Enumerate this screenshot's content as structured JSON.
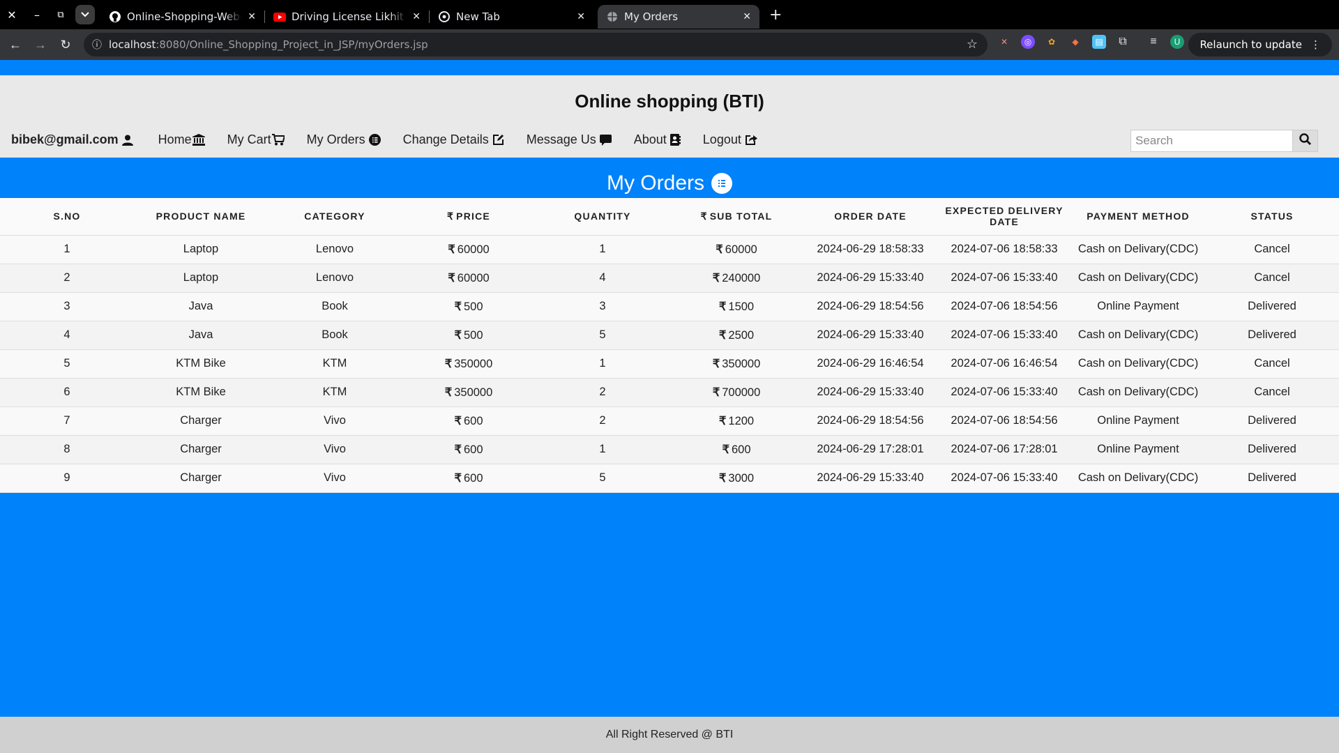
{
  "browser": {
    "tabs": [
      {
        "title": "Online-Shopping-Web-Project",
        "favicon": "github-icon",
        "active": false
      },
      {
        "title": "Driving License Likhit Questions",
        "favicon": "youtube-icon",
        "active": false
      },
      {
        "title": "New Tab",
        "favicon": "chrome-icon",
        "active": false
      },
      {
        "title": "My Orders",
        "favicon": "globe-icon",
        "active": true
      }
    ],
    "url_host": "localhost",
    "url_rest": ":8080/Online_Shopping_Project_in_JSP/myOrders.jsp",
    "relaunch_label": "Relaunch to update",
    "profile_initial": "U"
  },
  "header": {
    "site_title": "Online shopping (BTI)",
    "user_email": "bibek@gmail.com",
    "nav": {
      "home": "Home",
      "cart": "My Cart",
      "orders": "My Orders",
      "change_details": "Change Details",
      "message": "Message Us",
      "about": "About",
      "logout": "Logout"
    },
    "search_placeholder": "Search"
  },
  "page": {
    "title": "My Orders"
  },
  "table": {
    "columns": [
      "S.NO",
      "PRODUCT NAME",
      "CATEGORY",
      "PRICE",
      "QUANTITY",
      "SUB TOTAL",
      "ORDER DATE",
      "EXPECTED DELIVERY DATE",
      "PAYMENT METHOD",
      "STATUS"
    ],
    "currency_symbol": "₹",
    "rows": [
      {
        "sno": "1",
        "product": "Laptop",
        "category": "Lenovo",
        "price": "60000",
        "quantity": "1",
        "subtotal": "60000",
        "order_date": "2024-06-29 18:58:33",
        "delivery_date": "2024-07-06 18:58:33",
        "payment": "Cash on Delivary(CDC)",
        "status": "Cancel"
      },
      {
        "sno": "2",
        "product": "Laptop",
        "category": "Lenovo",
        "price": "60000",
        "quantity": "4",
        "subtotal": "240000",
        "order_date": "2024-06-29 15:33:40",
        "delivery_date": "2024-07-06 15:33:40",
        "payment": "Cash on Delivary(CDC)",
        "status": "Cancel"
      },
      {
        "sno": "3",
        "product": "Java",
        "category": "Book",
        "price": "500",
        "quantity": "3",
        "subtotal": "1500",
        "order_date": "2024-06-29 18:54:56",
        "delivery_date": "2024-07-06 18:54:56",
        "payment": "Online Payment",
        "status": "Delivered"
      },
      {
        "sno": "4",
        "product": "Java",
        "category": "Book",
        "price": "500",
        "quantity": "5",
        "subtotal": "2500",
        "order_date": "2024-06-29 15:33:40",
        "delivery_date": "2024-07-06 15:33:40",
        "payment": "Cash on Delivary(CDC)",
        "status": "Delivered"
      },
      {
        "sno": "5",
        "product": "KTM Bike",
        "category": "KTM",
        "price": "350000",
        "quantity": "1",
        "subtotal": "350000",
        "order_date": "2024-06-29 16:46:54",
        "delivery_date": "2024-07-06 16:46:54",
        "payment": "Cash on Delivary(CDC)",
        "status": "Cancel"
      },
      {
        "sno": "6",
        "product": "KTM Bike",
        "category": "KTM",
        "price": "350000",
        "quantity": "2",
        "subtotal": "700000",
        "order_date": "2024-06-29 15:33:40",
        "delivery_date": "2024-07-06 15:33:40",
        "payment": "Cash on Delivary(CDC)",
        "status": "Cancel"
      },
      {
        "sno": "7",
        "product": "Charger",
        "category": "Vivo",
        "price": "600",
        "quantity": "2",
        "subtotal": "1200",
        "order_date": "2024-06-29 18:54:56",
        "delivery_date": "2024-07-06 18:54:56",
        "payment": "Online Payment",
        "status": "Delivered"
      },
      {
        "sno": "8",
        "product": "Charger",
        "category": "Vivo",
        "price": "600",
        "quantity": "1",
        "subtotal": "600",
        "order_date": "2024-06-29 17:28:01",
        "delivery_date": "2024-07-06 17:28:01",
        "payment": "Online Payment",
        "status": "Delivered"
      },
      {
        "sno": "9",
        "product": "Charger",
        "category": "Vivo",
        "price": "600",
        "quantity": "5",
        "subtotal": "3000",
        "order_date": "2024-06-29 15:33:40",
        "delivery_date": "2024-07-06 15:33:40",
        "payment": "Cash on Delivary(CDC)",
        "status": "Delivered"
      }
    ]
  },
  "footer": {
    "text": "All Right Reserved @ BTI"
  },
  "colors": {
    "brand_blue": "#0082fb",
    "header_bg": "#e9e9e9",
    "footer_bg": "#d0d0d0"
  }
}
